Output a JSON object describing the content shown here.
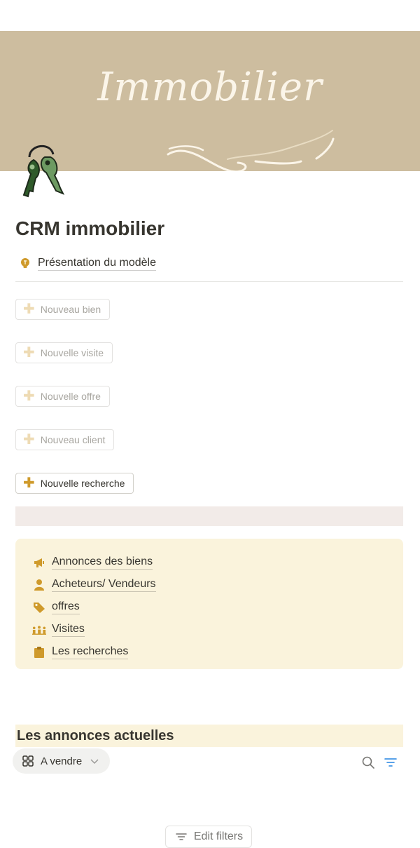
{
  "cover": {
    "title": "Immobilier"
  },
  "page": {
    "title": "CRM immobilier",
    "presentation_link": "Présentation du modèle"
  },
  "buttons": [
    {
      "label": "Nouveau bien"
    },
    {
      "label": "Nouvelle visite"
    },
    {
      "label": "Nouvelle offre"
    },
    {
      "label": "Nouveau client"
    },
    {
      "label": "Nouvelle recherche"
    }
  ],
  "nav_links": [
    {
      "label": "Annonces des biens",
      "icon": "megaphone-icon"
    },
    {
      "label": "Acheteurs/ Vendeurs",
      "icon": "person-icon"
    },
    {
      "label": "offres",
      "icon": "tag-icon"
    },
    {
      "label": "Visites",
      "icon": "people-icon"
    },
    {
      "label": "Les recherches",
      "icon": "clipboard-icon"
    }
  ],
  "section": {
    "title": "Les annonces actuelles",
    "view_tab": "A vendre",
    "edit_filters": "Edit filters"
  },
  "colors": {
    "cover_bg": "#cdbd9f",
    "accent": "#cf9a2b",
    "callout_bg": "#faf3dc",
    "key_green": "#3c6b35"
  }
}
